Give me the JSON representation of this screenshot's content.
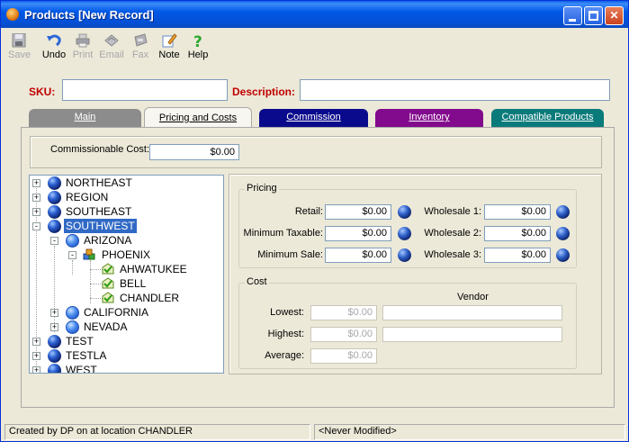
{
  "window": {
    "title": "Products [New Record]"
  },
  "toolbar": {
    "items": [
      {
        "label": "Save",
        "icon": "floppy-disk-icon",
        "enabled": false
      },
      {
        "label": "Undo",
        "icon": "undo-arrow-icon",
        "enabled": true
      },
      {
        "label": "Print",
        "icon": "printer-icon",
        "enabled": false
      },
      {
        "label": "Email",
        "icon": "email-icon",
        "enabled": false
      },
      {
        "label": "Fax",
        "icon": "fax-icon",
        "enabled": false
      },
      {
        "label": "Note",
        "icon": "note-pencil-icon",
        "enabled": true
      },
      {
        "label": "Help",
        "icon": "help-question-icon",
        "enabled": true
      }
    ]
  },
  "header": {
    "sku_label": "SKU:",
    "sku_value": "",
    "description_label": "Description:",
    "description_value": ""
  },
  "tabs": [
    {
      "label": "Main",
      "active": false,
      "color": "#8C8C8C"
    },
    {
      "label": "Pricing and Costs",
      "active": true,
      "color": "#F7F6F0"
    },
    {
      "label": "Commission",
      "active": false,
      "color": "#0A0A8C"
    },
    {
      "label": "Inventory",
      "active": false,
      "color": "#820A8C"
    },
    {
      "label": "Compatible Products",
      "active": false,
      "color": "#0A7A7A"
    }
  ],
  "commissionable": {
    "label": "Commissionable Cost:",
    "value": "$0.00"
  },
  "tree": {
    "nodes": [
      {
        "label": "NORTHEAST",
        "level": 0,
        "expander": "+",
        "icon": "globe-icon"
      },
      {
        "label": "REGION",
        "level": 0,
        "expander": "+",
        "icon": "globe-icon"
      },
      {
        "label": "SOUTHEAST",
        "level": 0,
        "expander": "+",
        "icon": "globe-icon"
      },
      {
        "label": "SOUTHWEST",
        "level": 0,
        "expander": "-",
        "icon": "globe-icon",
        "selected": true
      },
      {
        "label": "ARIZONA",
        "level": 1,
        "expander": "-",
        "icon": "state-globe-icon"
      },
      {
        "label": "PHOENIX",
        "level": 2,
        "expander": "-",
        "icon": "city-cubes-icon"
      },
      {
        "label": "AHWATUKEE",
        "level": 3,
        "expander": "",
        "icon": "location-check-icon"
      },
      {
        "label": "BELL",
        "level": 3,
        "expander": "",
        "icon": "location-check-icon"
      },
      {
        "label": "CHANDLER",
        "level": 3,
        "expander": "",
        "icon": "location-check-icon"
      },
      {
        "label": "CALIFORNIA",
        "level": 1,
        "expander": "+",
        "icon": "state-globe-icon"
      },
      {
        "label": "NEVADA",
        "level": 1,
        "expander": "+",
        "icon": "state-globe-icon"
      },
      {
        "label": "TEST",
        "level": 0,
        "expander": "+",
        "icon": "globe-icon"
      },
      {
        "label": "TESTLA",
        "level": 0,
        "expander": "+",
        "icon": "globe-icon"
      },
      {
        "label": "WEST",
        "level": 0,
        "expander": "+",
        "icon": "globe-icon"
      }
    ]
  },
  "pricing": {
    "title": "Pricing",
    "retail_label": "Retail:",
    "retail_value": "$0.00",
    "min_taxable_label": "Minimum Taxable:",
    "min_taxable_value": "$0.00",
    "min_sale_label": "Minimum Sale:",
    "min_sale_value": "$0.00",
    "wholesale1_label": "Wholesale 1:",
    "wholesale1_value": "$0.00",
    "wholesale2_label": "Wholesale 2:",
    "wholesale2_value": "$0.00",
    "wholesale3_label": "Wholesale 3:",
    "wholesale3_value": "$0.00"
  },
  "cost": {
    "title": "Cost",
    "vendor_header": "Vendor",
    "lowest_label": "Lowest:",
    "lowest_value": "$0.00",
    "lowest_vendor": "",
    "highest_label": "Highest:",
    "highest_value": "$0.00",
    "highest_vendor": "",
    "average_label": "Average:",
    "average_value": "$0.00"
  },
  "status": {
    "left": "Created by DP on  at location CHANDLER",
    "right": "<Never Modified>"
  }
}
